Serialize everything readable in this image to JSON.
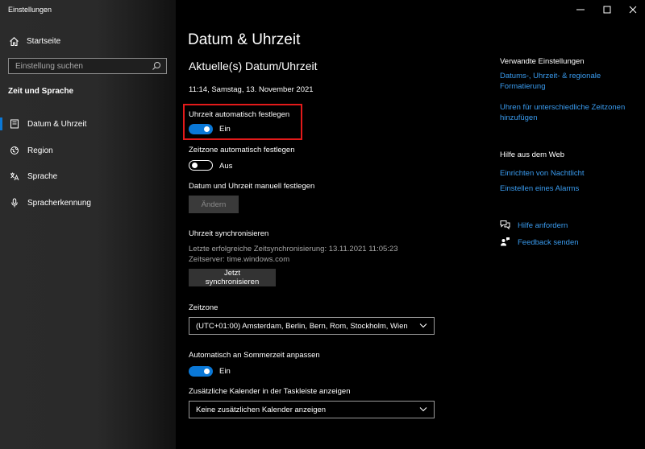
{
  "window": {
    "title": "Einstellungen"
  },
  "sidebar": {
    "home_label": "Startseite",
    "search_placeholder": "Einstellung suchen",
    "section": "Zeit und Sprache",
    "items": [
      {
        "label": "Datum & Uhrzeit",
        "icon": "clock-icon",
        "active": true
      },
      {
        "label": "Region",
        "icon": "globe-icon"
      },
      {
        "label": "Sprache",
        "icon": "language-icon"
      },
      {
        "label": "Spracherkennung",
        "icon": "microphone-icon"
      }
    ]
  },
  "main": {
    "title": "Datum & Uhrzeit",
    "subtitle": "Aktuelle(s) Datum/Uhrzeit",
    "current_datetime": "11:14, Samstag, 13. November 2021",
    "auto_time": {
      "label": "Uhrzeit automatisch festlegen",
      "state": "Ein",
      "on": true
    },
    "auto_zone": {
      "label": "Zeitzone automatisch festlegen",
      "state": "Aus",
      "on": false
    },
    "manual": {
      "label": "Datum und Uhrzeit manuell festlegen",
      "button": "Ändern"
    },
    "sync": {
      "heading": "Uhrzeit synchronisieren",
      "last_sync": "Letzte erfolgreiche Zeitsynchronisierung: 13.11.2021 11:05:23",
      "server": "Zeitserver: time.windows.com",
      "button": "Jetzt synchronisieren"
    },
    "timezone": {
      "label": "Zeitzone",
      "value": "(UTC+01:00) Amsterdam, Berlin, Bern, Rom, Stockholm, Wien"
    },
    "dst": {
      "label": "Automatisch an Sommerzeit anpassen",
      "state": "Ein",
      "on": true
    },
    "calendar": {
      "label": "Zusätzliche Kalender in der Taskleiste anzeigen",
      "value": "Keine zusätzlichen Kalender anzeigen"
    }
  },
  "related": {
    "heading": "Verwandte Einstellungen",
    "link1": "Datums-, Uhrzeit- & regionale Formatierung",
    "link2": "Uhren für unterschiedliche Zeitzonen hinzufügen",
    "web_heading": "Hilfe aus dem Web",
    "web_link1": "Einrichten von Nachtlicht",
    "web_link2": "Einstellen eines Alarms",
    "help": "Hilfe anfordern",
    "feedback": "Feedback senden"
  },
  "colors": {
    "accent": "#0a78d7",
    "link": "#3a9cf0",
    "highlight": "#e21a1a"
  }
}
